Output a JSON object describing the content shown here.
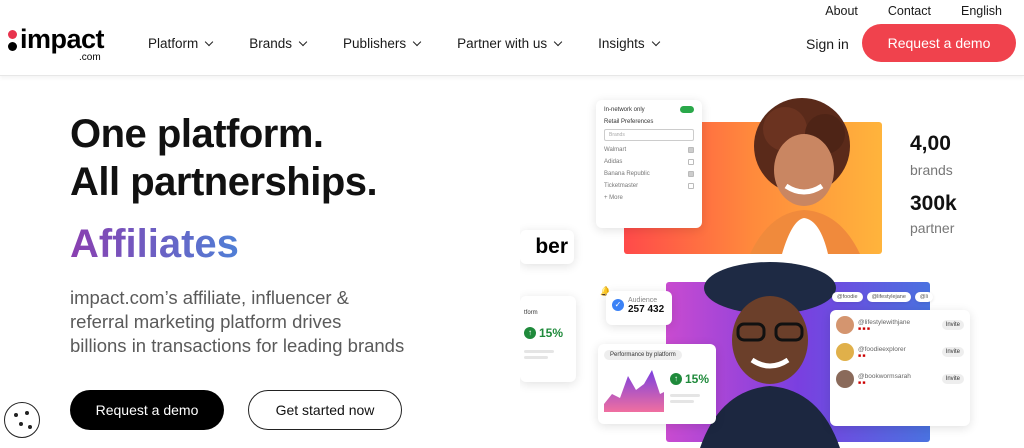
{
  "utility": [
    "About",
    "Contact",
    "English"
  ],
  "logo": {
    "word": "impact",
    "sub": ".com"
  },
  "nav": [
    "Platform",
    "Brands",
    "Publishers",
    "Partner with us",
    "Insights"
  ],
  "sign_in": "Sign in",
  "request_demo_top": "Request a demo",
  "hero": {
    "line1": "One platform.",
    "line2": "All partnerships.",
    "rotating": "Affiliates",
    "desc1": "impact.com’s affiliate, influencer &",
    "desc2": "referral marketing platform drives",
    "desc3": "billions in transactions for leading brands",
    "cta_primary": "Request a demo",
    "cta_secondary": "Get started now"
  },
  "visual": {
    "filter": {
      "in_network": "In-network only",
      "retail": "Retail Preferences",
      "placeholder": "Brands",
      "brands": [
        "Walmart",
        "Adidas",
        "Banana Republic",
        "Ticketmaster"
      ],
      "more": "+ More"
    },
    "stats": [
      {
        "value": "4,00",
        "label": "brands"
      },
      {
        "value": "300k",
        "label": "partner"
      }
    ],
    "uber": "ber",
    "audience": {
      "title": "Audience",
      "value": "257 432"
    },
    "platform_small": {
      "label": "tform",
      "pct": "15%"
    },
    "perf": {
      "title": "Performance by platform",
      "pct": "15%"
    },
    "tabs": [
      "@foodie",
      "@lifestylejane",
      "@li"
    ],
    "influencers": [
      {
        "handle": "@lifestylewithjane",
        "invite": "Invite"
      },
      {
        "handle": "@foodieexplorer",
        "invite": "Invite"
      },
      {
        "handle": "@bookwormsarah",
        "invite": "Invite"
      }
    ]
  }
}
